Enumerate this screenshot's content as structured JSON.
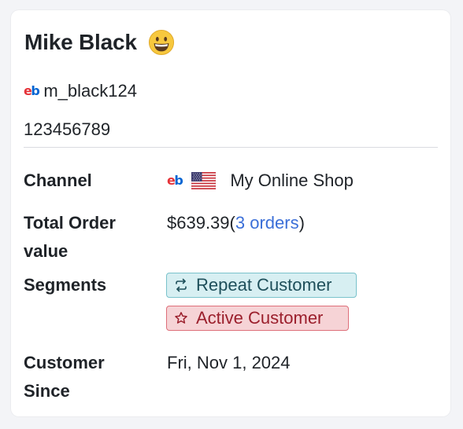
{
  "customer": {
    "name": "Mike Black",
    "emoji": "grinning-face-emoji",
    "platform_icon": "ebay-icon",
    "username": "m_black124",
    "id": "123456789"
  },
  "details": {
    "channel": {
      "label": "Channel",
      "platform_icon": "ebay-icon",
      "flag_icon": "us-flag-icon",
      "value": "My Online Shop"
    },
    "total_order_value": {
      "label_line1": "Total Order",
      "label_line2": "value",
      "amount": "$639.39",
      "open_paren": "(",
      "orders_link": "3 orders",
      "close_paren": ")"
    },
    "segments": {
      "label": "Segments",
      "items": [
        {
          "label": "Repeat Customer",
          "icon": "repeat-icon",
          "color": "#d7eff2",
          "border": "#79c2cb"
        },
        {
          "label": "Active Customer",
          "icon": "star-outline-icon",
          "color": "#f6d3d6",
          "border": "#de6f7a"
        }
      ]
    },
    "customer_since": {
      "label_line1": "Customer",
      "label_line2": "Since",
      "value": "Fri, Nov 1, 2024"
    }
  },
  "ebay_logo": {
    "e": "e",
    "b": "b"
  },
  "colors": {
    "link": "#3b6fd8",
    "background": "#f3f4f7",
    "card": "#ffffff"
  }
}
